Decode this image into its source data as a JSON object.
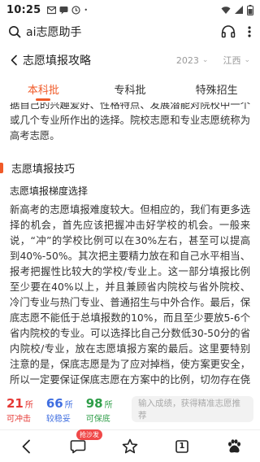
{
  "status_bar": {
    "time": "10:25"
  },
  "search": {
    "query": "ai志愿助手"
  },
  "nav": {
    "title": "志愿填报攻略",
    "year": "2023",
    "province": "江西"
  },
  "tabs": [
    {
      "label": "本科批"
    },
    {
      "label": "专科批"
    },
    {
      "label": "特殊招生"
    }
  ],
  "content": {
    "intro_text": "据自己的兴趣爱好、性格特点、发展潜能对院校中一个或几个专业所作出的选择。院校志愿和专业志愿统称为高考志愿。",
    "section_title": "志愿填报技巧",
    "subsection_title": "志愿填报梯度选择",
    "body_text": "新高考的志愿填报难度较大。但相应的，我们有更多选择的机会，首先应该把握冲击好学校的机会。一般来说，“冲”的学校比例可以在30%左右，甚至可以提高到40%-50%。其次把主要精力放在和自己水平相当、报考把握性比较大的学校/专业上。这一部分填报比例至少要在40%以上，并且兼顾省内院校与省外院校、冷门专业与热门专业、普通招生与中外合作。最后，保底志愿不能低于总填报数的10%，而且至少要放5-6个省内院校的专业。可以选择比自己分数低30-50分的省内院校/专业，放在志愿填报方案的最后。这里要特别注意的是，保底志愿是为了应对掉档，使方案更安全，所以一定要保证保底志愿在方案中的比例，切勿存在侥幸心理。"
  },
  "stats": {
    "rush": {
      "count": "21",
      "unit": "所",
      "label": "可冲击"
    },
    "stable": {
      "count": "66",
      "unit": "所",
      "label": "较稳妥"
    },
    "safe": {
      "count": "98",
      "unit": "所",
      "label": "可保底"
    },
    "input_placeholder": "输入成绩，获得精准志愿推荐"
  },
  "bottom_bar": {
    "chat_badge": "抢沙发",
    "tab_count": "1"
  },
  "colors": {
    "accent": "#f05a28",
    "red": "#e53935",
    "blue": "#3f6ee0",
    "green": "#2e9d48"
  }
}
